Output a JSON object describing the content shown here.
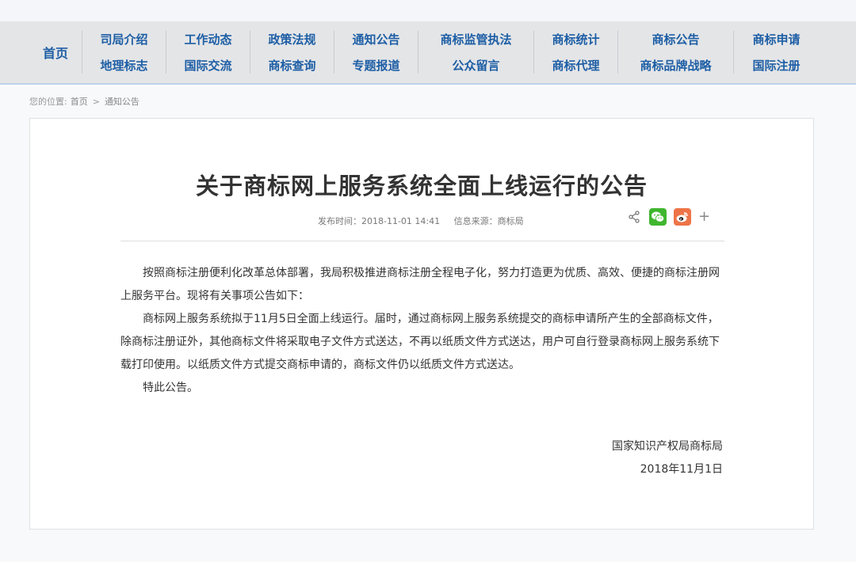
{
  "nav": {
    "home": "首页",
    "columns": [
      {
        "top": "司局介绍",
        "bottom": "地理标志"
      },
      {
        "top": "工作动态",
        "bottom": "国际交流"
      },
      {
        "top": "政策法规",
        "bottom": "商标查询"
      },
      {
        "top": "通知公告",
        "bottom": "专题报道"
      },
      {
        "top": "商标监管执法",
        "bottom": "公众留言"
      },
      {
        "top": "商标统计",
        "bottom": "商标代理"
      },
      {
        "top": "商标公告",
        "bottom": "商标品牌战略"
      },
      {
        "top": "商标申请",
        "bottom": "国际注册"
      }
    ]
  },
  "breadcrumb": {
    "prefix": "您的位置:",
    "home": "首页",
    "separator": ">",
    "current": "通知公告"
  },
  "article": {
    "title": "关于商标网上服务系统全面上线运行的公告",
    "publish_time": "发布时间：2018-11-01 14:41",
    "source": "信息来源：商标局",
    "paragraphs": [
      "按照商标注册便利化改革总体部署，我局积极推进商标注册全程电子化，努力打造更为优质、高效、便捷的商标注册网上服务平台。现将有关事项公告如下：",
      "商标网上服务系统拟于11月5日全面上线运行。届时，通过商标网上服务系统提交的商标申请所产生的全部商标文件，除商标注册证外，其他商标文件将采取电子文件方式送达，不再以纸质文件方式送达，用户可自行登录商标网上服务系统下载打印使用。以纸质文件方式提交商标申请的，商标文件仍以纸质文件方式送达。",
      "特此公告。"
    ],
    "signature_org": "国家知识产权局商标局",
    "signature_date": "2018年11月1日"
  },
  "share": {
    "icons": [
      "share-icon",
      "wechat-icon",
      "weibo-icon",
      "more-plus-icon"
    ],
    "plus": "+",
    "colors": {
      "wechat": "#3fb62f",
      "weibo": "#ee7448"
    }
  },
  "colors": {
    "nav_text": "#1d5ea5",
    "nav_bg": "#e4e5e7",
    "nav_border": "#bcd3ea"
  }
}
